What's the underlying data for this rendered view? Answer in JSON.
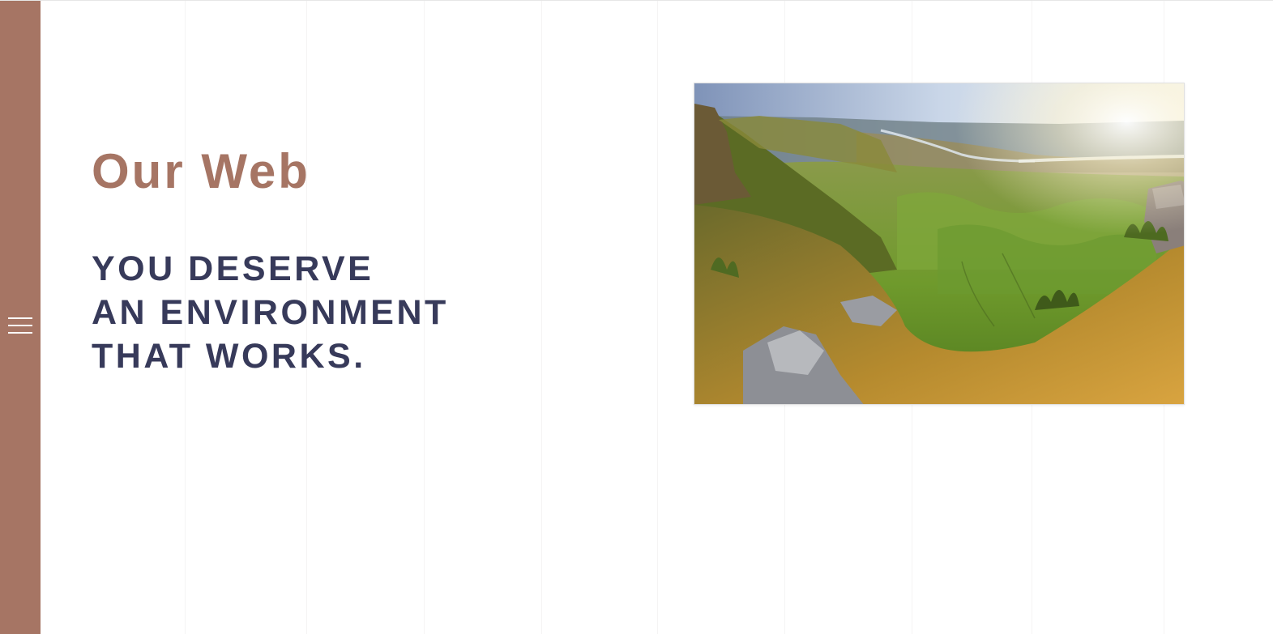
{
  "sidebar": {
    "background": "#a67564",
    "menu_icon": "hamburger-menu-icon"
  },
  "hero": {
    "title": "Our Web",
    "tagline_lines": [
      "YOU DESERVE",
      "AN ENVIRONMENT",
      "THAT WORKS."
    ],
    "title_color": "#a67564",
    "tagline_color": "#373a5a"
  },
  "image": {
    "subject": "sunlit green valley landscape photo"
  }
}
